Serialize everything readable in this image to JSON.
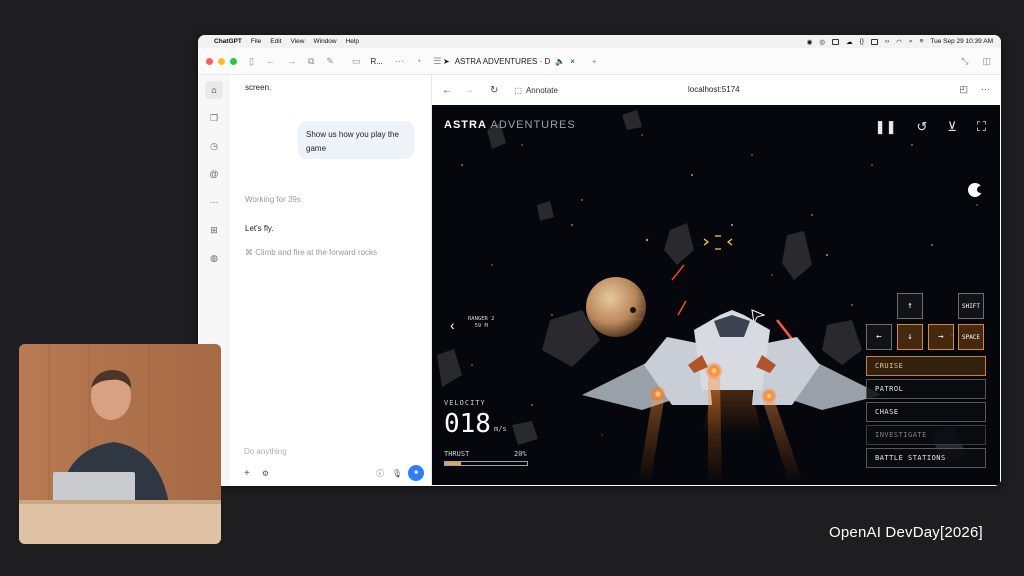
{
  "menubar": {
    "app": "ChatGPT",
    "items": [
      "File",
      "Edit",
      "View",
      "Window",
      "Help"
    ],
    "datetime": "Tue Sep 29  10:39 AM"
  },
  "toolbar": {
    "window_title": "R...",
    "browser_tab": "ASTRA ADVENTURES · D"
  },
  "chat": {
    "prior_text": "screen.",
    "user_message": "Show us how you play the game",
    "status": "Working for 39s",
    "reply": "Let's fly.",
    "action": "Climb and fire at the forward rocks",
    "composer_placeholder": "Do anything"
  },
  "browser": {
    "annotate_label": "Annotate",
    "url": "localhost:5174"
  },
  "game": {
    "title_bold": "ASTRA",
    "title_light": "ADVENTURES",
    "ranger_name": "RANGER 2",
    "ranger_dist": "59 M",
    "velocity_label": "VELOCITY",
    "velocity_value": "018",
    "velocity_unit": "m/s",
    "thrust_label": "THRUST",
    "thrust_pct": "20%",
    "thrust_fraction": 0.2,
    "keys": {
      "up": "↑",
      "left": "←",
      "down": "↓",
      "right": "→",
      "shift": "SHIFT",
      "space": "SPACE"
    },
    "modes": [
      {
        "label": "CRUISE",
        "state": "active"
      },
      {
        "label": "PATROL",
        "state": "normal"
      },
      {
        "label": "CHASE",
        "state": "normal"
      },
      {
        "label": "INVESTIGATE",
        "state": "dim"
      },
      {
        "label": "BATTLE STATIONS",
        "state": "normal"
      }
    ],
    "colors": {
      "accent": "#d48a3a",
      "background": "#05070c"
    }
  },
  "footer": {
    "brand": "OpenAI DevDay[2026]"
  }
}
